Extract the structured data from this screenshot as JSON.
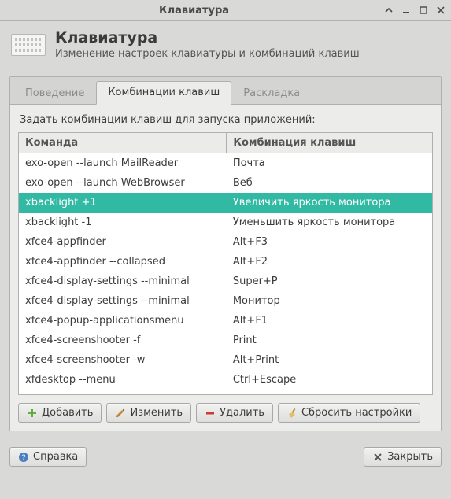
{
  "window": {
    "title": "Клавиатура"
  },
  "header": {
    "title": "Клавиатура",
    "subtitle": "Изменение настроек клавиатуры и комбинаций клавиш"
  },
  "tabs": {
    "behaviour": "Поведение",
    "shortcuts": "Комбинации клавиш",
    "layout": "Раскладка"
  },
  "instruction": "Задать комбинации клавиш для запуска приложений:",
  "columns": {
    "command": "Команда",
    "shortcut": "Комбинация клавиш"
  },
  "rows": [
    {
      "cmd": "exo-open --launch MailReader",
      "key": "Почта",
      "selected": false
    },
    {
      "cmd": "exo-open --launch WebBrowser",
      "key": "Веб",
      "selected": false
    },
    {
      "cmd": "xbacklight +1",
      "key": "Увеличить яркость монитора",
      "selected": true
    },
    {
      "cmd": "xbacklight -1",
      "key": "Уменьшить яркость монитора",
      "selected": false
    },
    {
      "cmd": "xfce4-appfinder",
      "key": "Alt+F3",
      "selected": false
    },
    {
      "cmd": "xfce4-appfinder --collapsed",
      "key": "Alt+F2",
      "selected": false
    },
    {
      "cmd": "xfce4-display-settings --minimal",
      "key": "Super+P",
      "selected": false
    },
    {
      "cmd": "xfce4-display-settings --minimal",
      "key": "Монитор",
      "selected": false
    },
    {
      "cmd": "xfce4-popup-applicationsmenu",
      "key": "Alt+F1",
      "selected": false
    },
    {
      "cmd": "xfce4-screenshooter -f",
      "key": "Print",
      "selected": false
    },
    {
      "cmd": "xfce4-screenshooter -w",
      "key": "Alt+Print",
      "selected": false
    },
    {
      "cmd": "xfdesktop --menu",
      "key": "Ctrl+Escape",
      "selected": false
    }
  ],
  "buttons": {
    "add": "Добавить",
    "edit": "Изменить",
    "remove": "Удалить",
    "reset": "Сбросить настройки",
    "help": "Справка",
    "close": "Закрыть"
  }
}
